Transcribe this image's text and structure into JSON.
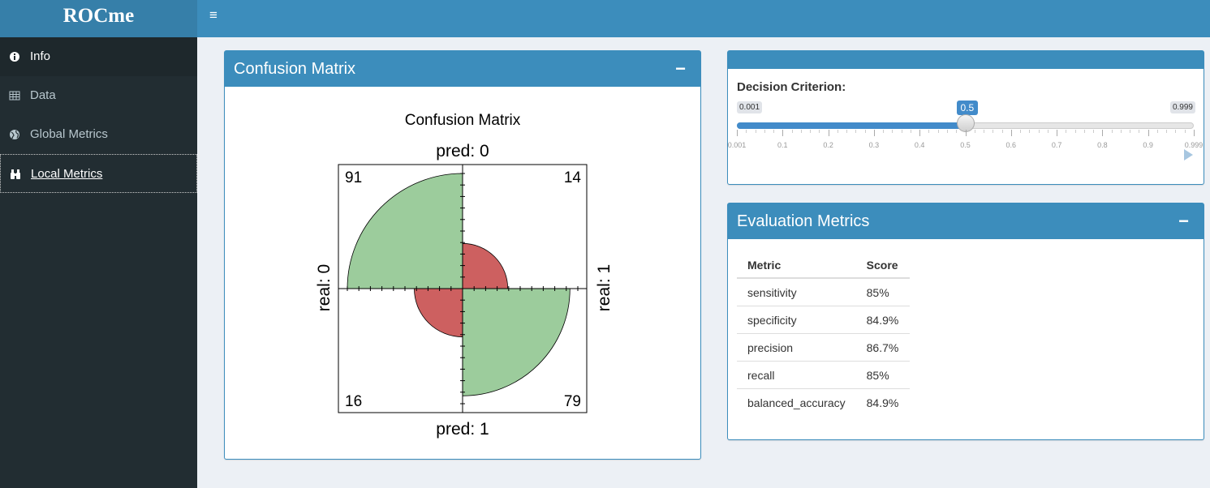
{
  "app": {
    "title": "ROCme",
    "menu_icon": "hamburger-icon"
  },
  "sidebar": {
    "items": [
      {
        "label": "Info",
        "icon": "info-circle-icon",
        "state": "active"
      },
      {
        "label": "Data",
        "icon": "table-icon",
        "state": "normal"
      },
      {
        "label": "Global Metrics",
        "icon": "globe-icon",
        "state": "normal"
      },
      {
        "label": "Local Metrics",
        "icon": "binoculars-icon",
        "state": "focused"
      }
    ]
  },
  "confusion_box": {
    "title": "Confusion Matrix",
    "collapse_label": "−",
    "chart_data": {
      "type": "fourfold",
      "title": "Confusion Matrix",
      "top_label": "pred: 0",
      "bottom_label": "pred: 1",
      "left_label": "real: 0",
      "right_label": "real: 1",
      "cells": [
        {
          "position": "top-left",
          "value": 91,
          "color": "#9ccc9c"
        },
        {
          "position": "top-right",
          "value": 14,
          "color": "#cd6060"
        },
        {
          "position": "bottom-left",
          "value": 16,
          "color": "#cd6060"
        },
        {
          "position": "bottom-right",
          "value": 79,
          "color": "#9ccc9c"
        }
      ]
    }
  },
  "criterion_box": {
    "label": "Decision Criterion:",
    "min": "0.001",
    "max": "0.999",
    "value": "0.5",
    "value_fraction": 0.5,
    "ticks": [
      "0.001",
      "0.1",
      "0.2",
      "0.3",
      "0.4",
      "0.5",
      "0.6",
      "0.7",
      "0.8",
      "0.9",
      "0.999"
    ],
    "play_icon": "play-icon"
  },
  "metrics_box": {
    "title": "Evaluation Metrics",
    "collapse_label": "−",
    "columns": [
      "Metric",
      "Score"
    ],
    "rows": [
      [
        "sensitivity",
        "85%"
      ],
      [
        "specificity",
        "84.9%"
      ],
      [
        "precision",
        "86.7%"
      ],
      [
        "recall",
        "85%"
      ],
      [
        "balanced_accuracy",
        "84.9%"
      ]
    ]
  },
  "colors": {
    "header": "#3c8dbc",
    "logo": "#367fa9",
    "sidebar": "#222d32",
    "accent": "#428bca"
  }
}
